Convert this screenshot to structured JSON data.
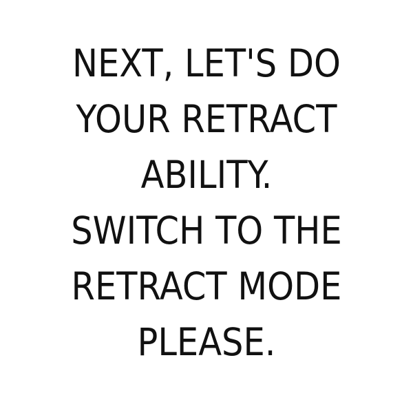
{
  "message": {
    "lines": [
      "NEXT, LET'S DO",
      "YOUR RETRACT",
      "ABILITY.",
      "SWITCH TO THE",
      "RETRACT MODE",
      "PLEASE."
    ]
  },
  "colors": {
    "background": "#ffffff",
    "text": "#111111"
  }
}
